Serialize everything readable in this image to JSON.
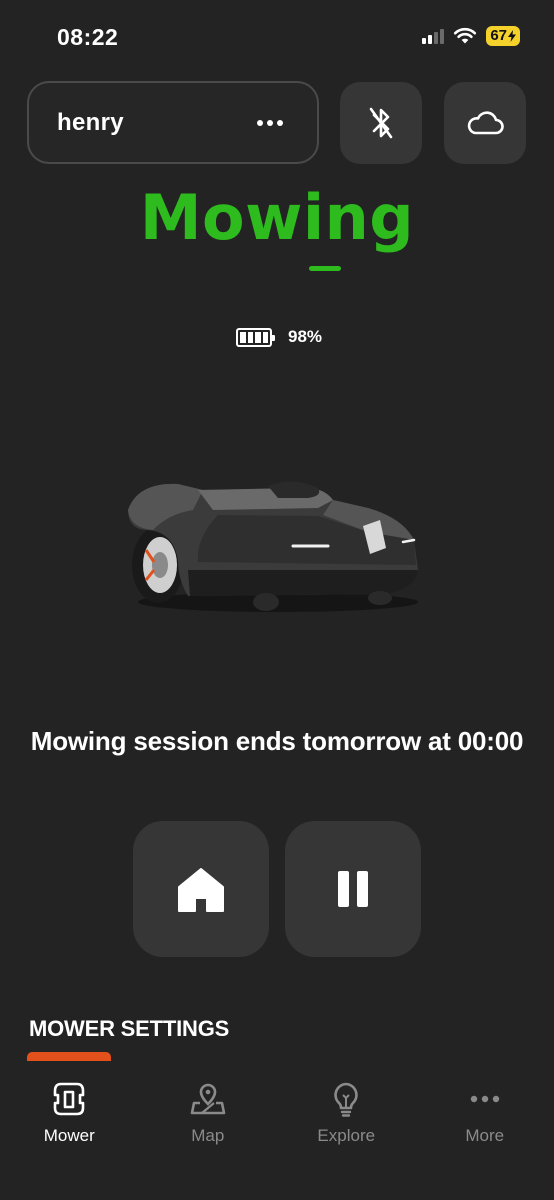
{
  "status_bar": {
    "time": "08:22",
    "battery": "67"
  },
  "header": {
    "mower_name": "henry"
  },
  "state": {
    "title": "Mowing",
    "battery_percent": "98%"
  },
  "session": {
    "text": "Mowing session ends tomorrow at 00:00"
  },
  "settings": {
    "title": "MOWER SETTINGS"
  },
  "nav": [
    {
      "label": "Mower",
      "icon": "mower-icon",
      "active": true
    },
    {
      "label": "Map",
      "icon": "map-icon",
      "active": false
    },
    {
      "label": "Explore",
      "icon": "lightbulb-icon",
      "active": false
    },
    {
      "label": "More",
      "icon": "more-dots-icon",
      "active": false
    }
  ],
  "colors": {
    "accent_green": "#2dbb1e",
    "accent_orange": "#e2501c",
    "background": "#232323",
    "button": "#363636"
  }
}
